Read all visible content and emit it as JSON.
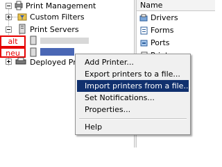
{
  "tree": {
    "root": "Print Management",
    "custom_filters": "Custom Filters",
    "print_servers": "Print Servers",
    "deployed": "Deployed Pr"
  },
  "annotations": {
    "alt": "alt",
    "neu": "neu"
  },
  "right_panel": {
    "header": "Name",
    "items": [
      "Drivers",
      "Forms",
      "Ports",
      "Printers"
    ]
  },
  "context_menu": {
    "items": [
      "Add Printer...",
      "Export printers to a file...",
      "Import printers from a file...",
      "Set Notifications...",
      "Properties...",
      "Help"
    ],
    "highlighted": "Import printers from a file..."
  }
}
